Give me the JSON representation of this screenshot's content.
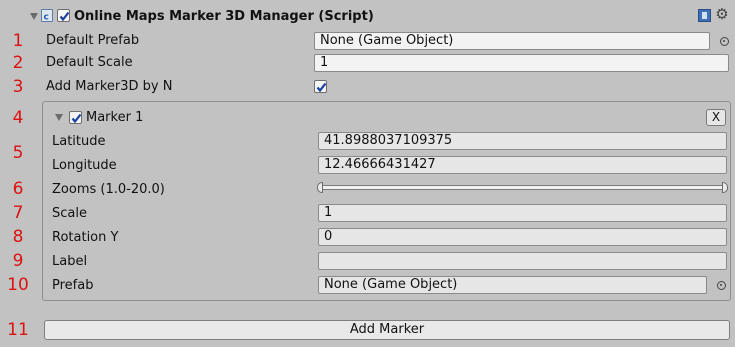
{
  "header": {
    "title": "Online Maps Marker 3D Manager (Script)",
    "script_icon": "script-icon",
    "enabled": true,
    "help_icon": "help-book-icon",
    "settings_icon": "gear-icon"
  },
  "row_numbers": [
    "1",
    "2",
    "3",
    "4",
    "5",
    "6",
    "7",
    "8",
    "9",
    "10",
    "11"
  ],
  "manager": {
    "default_prefab_label": "Default Prefab",
    "default_prefab_value": "None (Game Object)",
    "default_scale_label": "Default Scale",
    "default_scale_value": "1",
    "add_by_n_label": "Add Marker3D by N",
    "add_by_n_checked": true
  },
  "marker": {
    "title": "Marker 1",
    "enabled": true,
    "remove_label": "X",
    "latitude_label": "Latitude",
    "latitude_value": "41.8988037109375",
    "longitude_label": "Longitude",
    "longitude_value": "12.46666431427",
    "zooms_label": "Zooms (1.0-20.0)",
    "zoom_range": [
      1.0,
      20.0
    ],
    "scale_label": "Scale",
    "scale_value": "1",
    "rotation_label": "Rotation Y",
    "rotation_value": "0",
    "label_label": "Label",
    "label_value": "",
    "prefab_label": "Prefab",
    "prefab_value": "None (Game Object)"
  },
  "add_marker_label": "Add Marker",
  "colors": {
    "background": "#c2c2c2",
    "row_number": "#dd1111",
    "field": "#f3f3f3",
    "button": "#e9e9e9"
  }
}
